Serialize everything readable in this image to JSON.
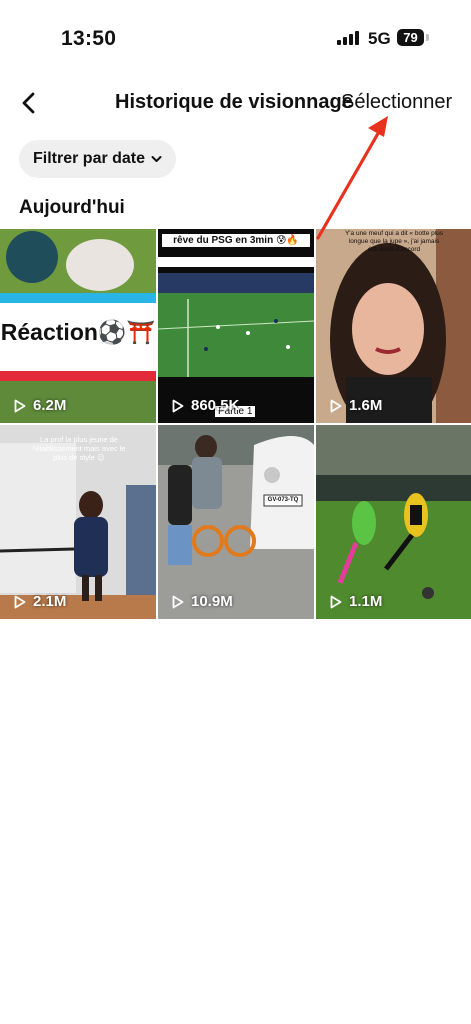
{
  "status_bar": {
    "time": "13:50",
    "network": "5G",
    "battery": "79"
  },
  "header": {
    "title": "Historique de visionnage",
    "select_label": "Sélectionner"
  },
  "filter": {
    "label": "Filtrer par date"
  },
  "section": {
    "title": "Aujourd'hui"
  },
  "videos": [
    {
      "views": "6.2M",
      "overlay_text": "Réaction⚽⛩️"
    },
    {
      "views": "860.5K",
      "overlay_text": "rêve du PSG en 3min 😰🔥",
      "label": "Partie 1"
    },
    {
      "views": "1.6M",
      "overlay_text": "Y'a une meuf qui a dit « botte plus longue que la jupe », j'ai jamais été aussi d'accord"
    },
    {
      "views": "2.1M",
      "overlay_text": "La prof la plus jeune de l'établissement mais avec le plus de style 😉"
    },
    {
      "views": "10.9M",
      "plate_text": "GV-073-TQ"
    },
    {
      "views": "1.1M"
    }
  ],
  "colors": {
    "annotation_arrow": "#e8321e",
    "chip_bg": "#efefef",
    "text": "#111111"
  }
}
